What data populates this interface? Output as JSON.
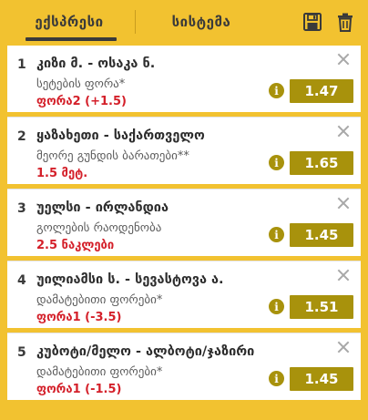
{
  "tabs": {
    "express": "ექსპრესი",
    "system": "სისტემა"
  },
  "header_icons": [
    "save-icon",
    "trash-icon"
  ],
  "colors": {
    "background": "#f2c230",
    "odds": "#a8920c",
    "outcome": "#d4202a"
  },
  "bets": [
    {
      "index": "1",
      "match": "კიზი მ. - ოსაკა ნ.",
      "market": "სეტების ფორა*",
      "outcome": "ფორა2 (+1.5)",
      "odds": "1.47"
    },
    {
      "index": "2",
      "match": "ყაზახეთი - საქართველო",
      "market": "მეორე გუნდის ბარათები**",
      "outcome": "1.5 მეტ.",
      "odds": "1.65"
    },
    {
      "index": "3",
      "match": "უელსი - ირლანდია",
      "market": "გოლების რაოდენობა",
      "outcome": "2.5 ნაკლები",
      "odds": "1.45"
    },
    {
      "index": "4",
      "match": "უილიამსი ს. - სევასტოვა ა.",
      "market": "დამატებითი ფორები*",
      "outcome": "ფორა1 (-3.5)",
      "odds": "1.51"
    },
    {
      "index": "5",
      "match": "კუბოტი/მელო - ალბოტი/ჯაზირი",
      "market": "დამატებითი ფორები*",
      "outcome": "ფორა1 (-1.5)",
      "odds": "1.45"
    }
  ]
}
